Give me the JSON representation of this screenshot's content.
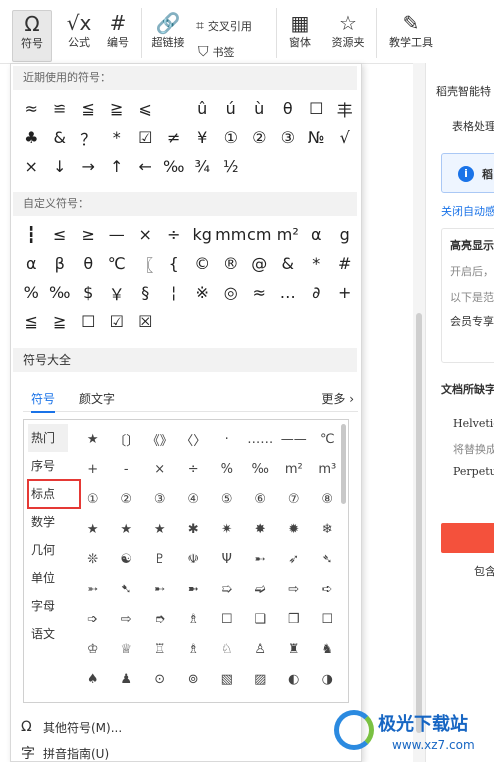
{
  "ribbon": {
    "symbol": {
      "icon": "omega-icon",
      "glyph": "Ω",
      "label": "符号"
    },
    "formula": {
      "icon": "formula-icon",
      "glyph": "√x",
      "label": "公式"
    },
    "numbering": {
      "icon": "numbering-icon",
      "glyph": "#",
      "label": "编号"
    },
    "hyperlink": {
      "icon": "link-icon",
      "glyph": "🔗",
      "label": "超链接"
    },
    "crossref": {
      "icon": "crossref-icon",
      "glyph": "⌗",
      "label": "交叉引用"
    },
    "bookmark": {
      "icon": "bookmark-icon",
      "glyph": "⛉",
      "label": "书签"
    },
    "form": {
      "icon": "form-icon",
      "glyph": "▦",
      "label": "窗体"
    },
    "resources": {
      "icon": "star-icon",
      "glyph": "☆",
      "label": "资源夹"
    },
    "teaching": {
      "icon": "teaching-icon",
      "glyph": "✎",
      "label": "教学工具"
    }
  },
  "panel": {
    "recent_title": "近期使用的符号：",
    "recent": [
      "≈",
      "≌",
      "≦",
      "≧",
      "⩽",
      "",
      "û",
      "ú",
      "ù",
      "θ",
      "☐",
      "丰",
      "♣",
      "&",
      "？",
      "*",
      "☑",
      "≠",
      "¥",
      "①",
      "②",
      "③",
      "№",
      "√",
      "×",
      "↓",
      "→",
      "↑",
      "←",
      "‰",
      "¾",
      "½"
    ],
    "custom_title": "自定义符号：",
    "custom": [
      "┇",
      "≤",
      "≥",
      "—",
      "×",
      "÷",
      "kg",
      "mm",
      "cm",
      "m²",
      "α",
      "g",
      "α",
      "β",
      "θ",
      "℃",
      "〖",
      "{",
      "©",
      "®",
      "@",
      "&",
      "*",
      "#",
      "%",
      "‰",
      "$",
      "￥",
      "§",
      "¦",
      "※",
      "◎",
      "≈",
      "…",
      "∂",
      "+",
      "≦",
      "≧",
      "☐",
      "☑",
      "☒"
    ],
    "all_title": "符号大全",
    "tabs": [
      "符号",
      "颜文字"
    ],
    "more": "更多 ›",
    "categories": [
      "热门",
      "序号",
      "标点",
      "数学",
      "几何",
      "单位",
      "字母",
      "语文"
    ],
    "grid": [
      "★",
      "〔〕",
      "《》",
      "〈〉",
      "·",
      "……",
      "——",
      "℃",
      "+",
      "-",
      "×",
      "÷",
      "%",
      "‰",
      "m²",
      "m³",
      "①",
      "②",
      "③",
      "④",
      "⑤",
      "⑥",
      "⑦",
      "⑧",
      "★",
      "★",
      "★",
      "✱",
      "✷",
      "✸",
      "✹",
      "❄",
      "❊",
      "☯",
      "♇",
      "☫",
      "Ψ",
      "➸",
      "➶",
      "➴",
      "➵",
      "➷",
      "➸",
      "➼",
      "➯",
      "➫",
      "⇨",
      "➪",
      "➩",
      "⇨",
      "➮",
      "♗",
      "☐",
      "❑",
      "❒",
      "☐",
      "♔",
      "♕",
      "♖",
      "♗",
      "♘",
      "♙",
      "♜",
      "♞",
      "♠",
      "♟",
      "⊙",
      "⊚",
      "▧",
      "▨",
      "◐",
      "◑"
    ],
    "other_symbols": "其他符号(M)...",
    "pinyin_guide": "拼音指南(U)"
  },
  "right_panel": {
    "title": "稻壳智能特",
    "item1": "表格处理",
    "info_text": "稻",
    "link": "关闭自动感",
    "heading": "高亮显示",
    "line1": "开启后，",
    "line2": "以下是范",
    "member": "会员专享",
    "missing": "文档所缺字",
    "font1": "Helvetic",
    "replace": "将替换成",
    "font2": "Perpetu",
    "bottom": "包含"
  },
  "watermark": {
    "line1": "极光下载站",
    "line2": "www.xz7.com"
  }
}
